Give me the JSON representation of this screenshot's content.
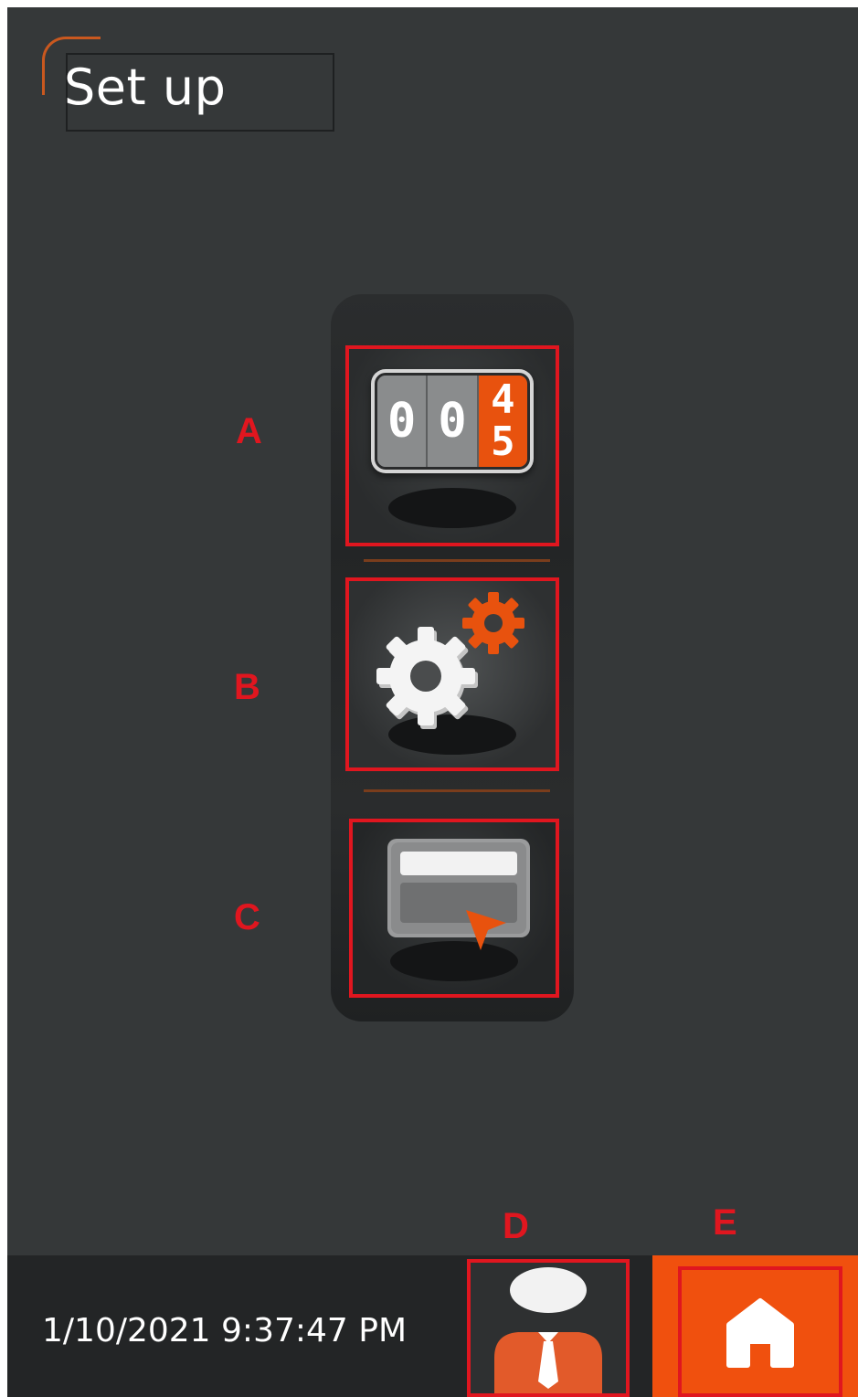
{
  "header": {
    "title": "Set up"
  },
  "menu": {
    "items": [
      {
        "marker": "A",
        "icon": "counter-icon",
        "counter_digits": [
          "0",
          "0",
          "4",
          "5"
        ]
      },
      {
        "marker": "B",
        "icon": "gears-icon"
      },
      {
        "marker": "C",
        "icon": "display-cursor-icon"
      }
    ]
  },
  "footer": {
    "datetime": "1/10/2021 9:37:47 PM",
    "operator_marker": "D",
    "home_marker": "E"
  },
  "colors": {
    "accent": "#f0500e",
    "background": "#353839",
    "highlight": "#e0161f"
  }
}
